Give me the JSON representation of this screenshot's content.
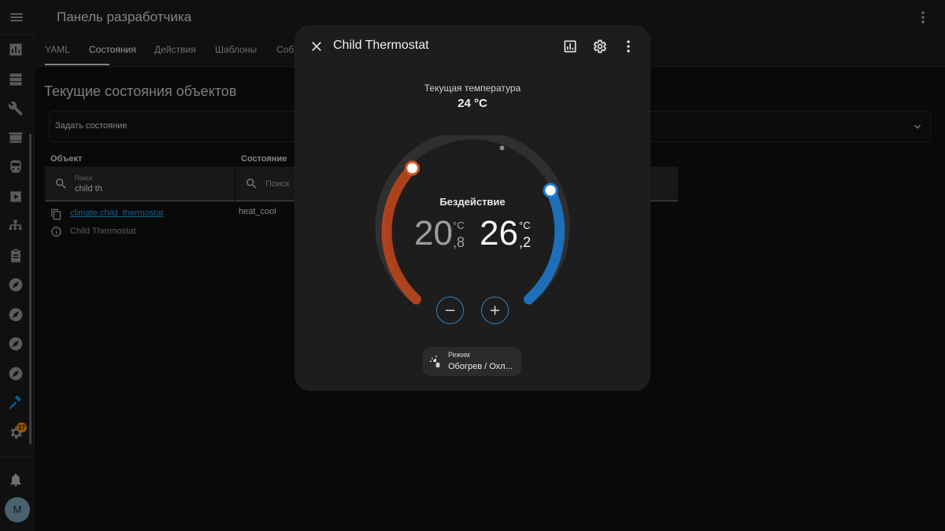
{
  "header": {
    "title": "Панель разработчика"
  },
  "tabs": [
    {
      "label": "YAML"
    },
    {
      "label": "Состояния"
    },
    {
      "label": "Действия"
    },
    {
      "label": "Шаблоны"
    },
    {
      "label": "Собы"
    }
  ],
  "main": {
    "section_title": "Текущие состояния объектов",
    "set_state_label": "Задать состояние",
    "columns": {
      "entity": "Объект",
      "state": "Состояние"
    },
    "filter_entity": {
      "label": "Поиск",
      "value": "child th"
    },
    "filter_state": {
      "placeholder": "Поиск"
    },
    "row": {
      "entity_id": "climate.child_thermostat",
      "friendly_name": "Child Thermostat",
      "state": "heat_cool"
    }
  },
  "sidebar": {
    "notification_badge": "17",
    "avatar_initial": "M"
  },
  "dialog": {
    "title": "Child Thermostat",
    "current_temp_label": "Текущая температура",
    "current_temp_value": "24 °C",
    "action_label": "Бездействие",
    "low": {
      "int": "20",
      "unit": "°C",
      "dec": ",8"
    },
    "high": {
      "int": "26",
      "unit": "°C",
      "dec": ",2"
    },
    "mode_label": "Режим",
    "mode_value": "Обогрев / Охл..."
  },
  "colors": {
    "accent": "#03a9f4",
    "heat": "#c4471c",
    "cool": "#1e6fb8"
  }
}
